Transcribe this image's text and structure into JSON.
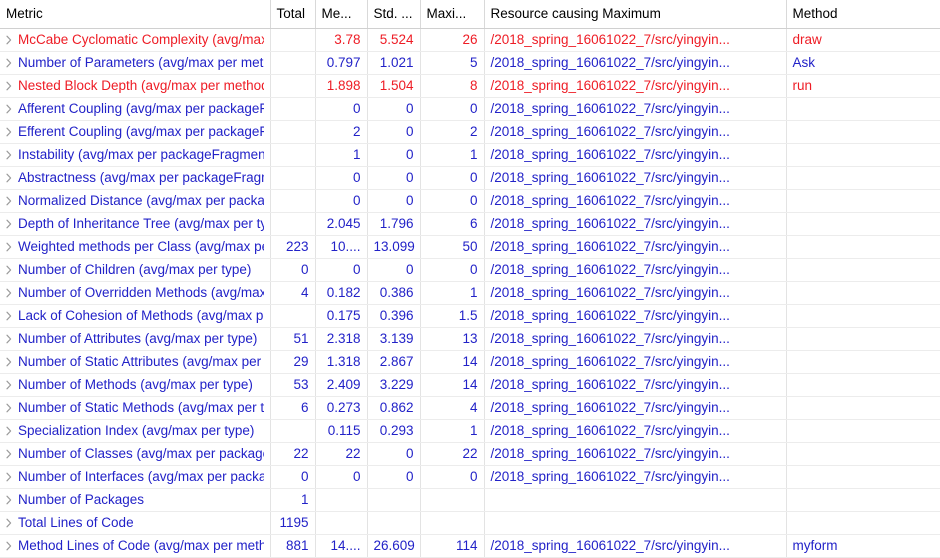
{
  "table": {
    "columns": [
      {
        "key": "metric",
        "label": "Metric",
        "align": "left"
      },
      {
        "key": "total",
        "label": "Total",
        "align": "right"
      },
      {
        "key": "mean",
        "label": "Me...",
        "align": "right"
      },
      {
        "key": "std",
        "label": "Std. ...",
        "align": "right"
      },
      {
        "key": "max",
        "label": "Maxi...",
        "align": "right"
      },
      {
        "key": "resource",
        "label": "Resource causing Maximum",
        "align": "left"
      },
      {
        "key": "method",
        "label": "Method",
        "align": "left"
      }
    ],
    "colors": {
      "red": "#ee1c25",
      "blue": "#2222c8",
      "header_text": "#000000",
      "grid": "#e3e3e3",
      "background": "#ffffff",
      "twisty": "#9a9a9a"
    },
    "rows": [
      {
        "metric": "McCabe Cyclomatic Complexity (avg/max per method)",
        "total": "",
        "mean": "3.78",
        "std": "5.524",
        "max": "26",
        "resource": "/2018_spring_16061022_7/src/yingyin...",
        "method": "draw",
        "color": "red",
        "expandable": true
      },
      {
        "metric": "Number of Parameters (avg/max per method)",
        "total": "",
        "mean": "0.797",
        "std": "1.021",
        "max": "5",
        "resource": "/2018_spring_16061022_7/src/yingyin...",
        "method": "Ask",
        "color": "blue",
        "expandable": true
      },
      {
        "metric": "Nested Block Depth (avg/max per method)",
        "total": "",
        "mean": "1.898",
        "std": "1.504",
        "max": "8",
        "resource": "/2018_spring_16061022_7/src/yingyin...",
        "method": "run",
        "color": "red",
        "expandable": true
      },
      {
        "metric": "Afferent Coupling (avg/max per packageFragment)",
        "total": "",
        "mean": "0",
        "std": "0",
        "max": "0",
        "resource": "/2018_spring_16061022_7/src/yingyin...",
        "method": "",
        "color": "blue",
        "expandable": true
      },
      {
        "metric": "Efferent Coupling (avg/max per packageFragment)",
        "total": "",
        "mean": "2",
        "std": "0",
        "max": "2",
        "resource": "/2018_spring_16061022_7/src/yingyin...",
        "method": "",
        "color": "blue",
        "expandable": true
      },
      {
        "metric": "Instability (avg/max per packageFragment)",
        "total": "",
        "mean": "1",
        "std": "0",
        "max": "1",
        "resource": "/2018_spring_16061022_7/src/yingyin...",
        "method": "",
        "color": "blue",
        "expandable": true
      },
      {
        "metric": "Abstractness (avg/max per packageFragment)",
        "total": "",
        "mean": "0",
        "std": "0",
        "max": "0",
        "resource": "/2018_spring_16061022_7/src/yingyin...",
        "method": "",
        "color": "blue",
        "expandable": true
      },
      {
        "metric": "Normalized Distance (avg/max per packageFragment)",
        "total": "",
        "mean": "0",
        "std": "0",
        "max": "0",
        "resource": "/2018_spring_16061022_7/src/yingyin...",
        "method": "",
        "color": "blue",
        "expandable": true
      },
      {
        "metric": "Depth of Inheritance Tree (avg/max per type)",
        "total": "",
        "mean": "2.045",
        "std": "1.796",
        "max": "6",
        "resource": "/2018_spring_16061022_7/src/yingyin...",
        "method": "",
        "color": "blue",
        "expandable": true
      },
      {
        "metric": "Weighted methods per Class (avg/max per type)",
        "total": "223",
        "mean": "10....",
        "std": "13.099",
        "max": "50",
        "resource": "/2018_spring_16061022_7/src/yingyin...",
        "method": "",
        "color": "blue",
        "expandable": true
      },
      {
        "metric": "Number of Children (avg/max per type)",
        "total": "0",
        "mean": "0",
        "std": "0",
        "max": "0",
        "resource": "/2018_spring_16061022_7/src/yingyin...",
        "method": "",
        "color": "blue",
        "expandable": true
      },
      {
        "metric": "Number of Overridden Methods (avg/max per type)",
        "total": "4",
        "mean": "0.182",
        "std": "0.386",
        "max": "1",
        "resource": "/2018_spring_16061022_7/src/yingyin...",
        "method": "",
        "color": "blue",
        "expandable": true
      },
      {
        "metric": "Lack of Cohesion of Methods (avg/max per type)",
        "total": "",
        "mean": "0.175",
        "std": "0.396",
        "max": "1.5",
        "resource": "/2018_spring_16061022_7/src/yingyin...",
        "method": "",
        "color": "blue",
        "expandable": true
      },
      {
        "metric": "Number of Attributes (avg/max per type)",
        "total": "51",
        "mean": "2.318",
        "std": "3.139",
        "max": "13",
        "resource": "/2018_spring_16061022_7/src/yingyin...",
        "method": "",
        "color": "blue",
        "expandable": true
      },
      {
        "metric": "Number of Static Attributes (avg/max per type)",
        "total": "29",
        "mean": "1.318",
        "std": "2.867",
        "max": "14",
        "resource": "/2018_spring_16061022_7/src/yingyin...",
        "method": "",
        "color": "blue",
        "expandable": true
      },
      {
        "metric": "Number of Methods (avg/max per type)",
        "total": "53",
        "mean": "2.409",
        "std": "3.229",
        "max": "14",
        "resource": "/2018_spring_16061022_7/src/yingyin...",
        "method": "",
        "color": "blue",
        "expandable": true
      },
      {
        "metric": "Number of Static Methods (avg/max per type)",
        "total": "6",
        "mean": "0.273",
        "std": "0.862",
        "max": "4",
        "resource": "/2018_spring_16061022_7/src/yingyin...",
        "method": "",
        "color": "blue",
        "expandable": true
      },
      {
        "metric": "Specialization Index (avg/max per type)",
        "total": "",
        "mean": "0.115",
        "std": "0.293",
        "max": "1",
        "resource": "/2018_spring_16061022_7/src/yingyin...",
        "method": "",
        "color": "blue",
        "expandable": true
      },
      {
        "metric": "Number of Classes (avg/max per packageFragment)",
        "total": "22",
        "mean": "22",
        "std": "0",
        "max": "22",
        "resource": "/2018_spring_16061022_7/src/yingyin...",
        "method": "",
        "color": "blue",
        "expandable": true
      },
      {
        "metric": "Number of Interfaces (avg/max per packageFragment)",
        "total": "0",
        "mean": "0",
        "std": "0",
        "max": "0",
        "resource": "/2018_spring_16061022_7/src/yingyin...",
        "method": "",
        "color": "blue",
        "expandable": true
      },
      {
        "metric": "Number of Packages",
        "total": "1",
        "mean": "",
        "std": "",
        "max": "",
        "resource": "",
        "method": "",
        "color": "blue",
        "expandable": true
      },
      {
        "metric": "Total Lines of Code",
        "total": "1195",
        "mean": "",
        "std": "",
        "max": "",
        "resource": "",
        "method": "",
        "color": "blue",
        "expandable": true
      },
      {
        "metric": "Method Lines of Code (avg/max per method)",
        "total": "881",
        "mean": "14....",
        "std": "26.609",
        "max": "114",
        "resource": "/2018_spring_16061022_7/src/yingyin...",
        "method": "myform",
        "color": "blue",
        "expandable": true
      }
    ]
  }
}
